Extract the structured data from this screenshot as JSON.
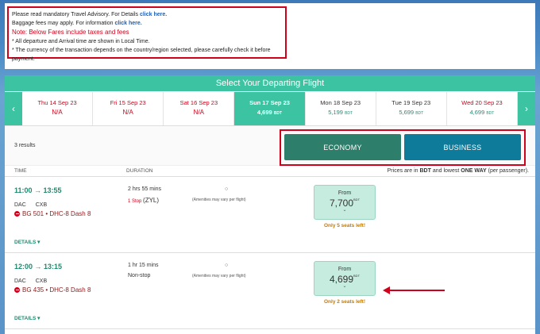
{
  "notice": {
    "line1_text": "Please read mandatory Travel Advisory. For Details",
    "line1_link": "click here.",
    "line2_text": "Baggage fees may apply. For information",
    "line2_link": "click here.",
    "line3": "Note: Below Fares include taxes and fees",
    "line4": "* All departure and Arrival time are shown in Local Time.",
    "line5": "* The currency of the transaction depends on the country/region selected, please carefully check it before payment."
  },
  "header": {
    "title": "Select Your Departing Flight"
  },
  "dates": [
    {
      "label": "Thu 14 Sep 23",
      "price": "N/A",
      "currency": ""
    },
    {
      "label": "Fri 15 Sep 23",
      "price": "N/A",
      "currency": ""
    },
    {
      "label": "Sat 16 Sep 23",
      "price": "N/A",
      "currency": ""
    },
    {
      "label": "Sun 17 Sep 23",
      "price": "4,699",
      "currency": "BDT"
    },
    {
      "label": "Mon 18 Sep 23",
      "price": "5,199",
      "currency": "BDT"
    },
    {
      "label": "Tue 19 Sep 23",
      "price": "5,699",
      "currency": "BDT"
    },
    {
      "label": "Wed 20 Sep 23",
      "price": "4,699",
      "currency": "BDT"
    }
  ],
  "results": {
    "count": "3 results",
    "economy_label": "ECONOMY",
    "business_label": "BUSINESS"
  },
  "columns": {
    "time": "TIME",
    "duration": "DURATION",
    "note_pre": "Prices are in",
    "note_currency": "BDT",
    "note_mid": "and lowest",
    "note_way": "ONE WAY",
    "note_post": "(per passenger)."
  },
  "flights": [
    {
      "times": "11:00 → 13:55",
      "origin": "DAC",
      "destination": "CXB",
      "flight": "BG 501 • DHC-8 Dash 8",
      "duration": "2 hrs 55 mins",
      "stops": "1 Stop",
      "via": "(ZYL)",
      "amenity_icon": "○",
      "amenities": "(Amenities may vary per flight)",
      "from": "From",
      "price": "7,700",
      "currency": "BDT",
      "chev": "⌄",
      "seats": "Only 5 seats left!",
      "details": "DETAILS ▾"
    },
    {
      "times": "12:00 → 13:15",
      "origin": "DAC",
      "destination": "CXB",
      "flight": "BG 435 • DHC-8 Dash 8",
      "duration": "1 hr 15 mins",
      "stops": "Non-stop",
      "via": "",
      "amenity_icon": "○",
      "amenities": "(Amenities may vary per flight)",
      "from": "From",
      "price": "4,699",
      "currency": "BDT",
      "chev": "⌄",
      "seats": "Only 2 seats left!",
      "details": "DETAILS ▾"
    }
  ],
  "colors": {
    "accent": "#3cc3a2",
    "economy": "#2d7f6c",
    "business": "#0f7b9a",
    "highlight": "#d0021b"
  }
}
